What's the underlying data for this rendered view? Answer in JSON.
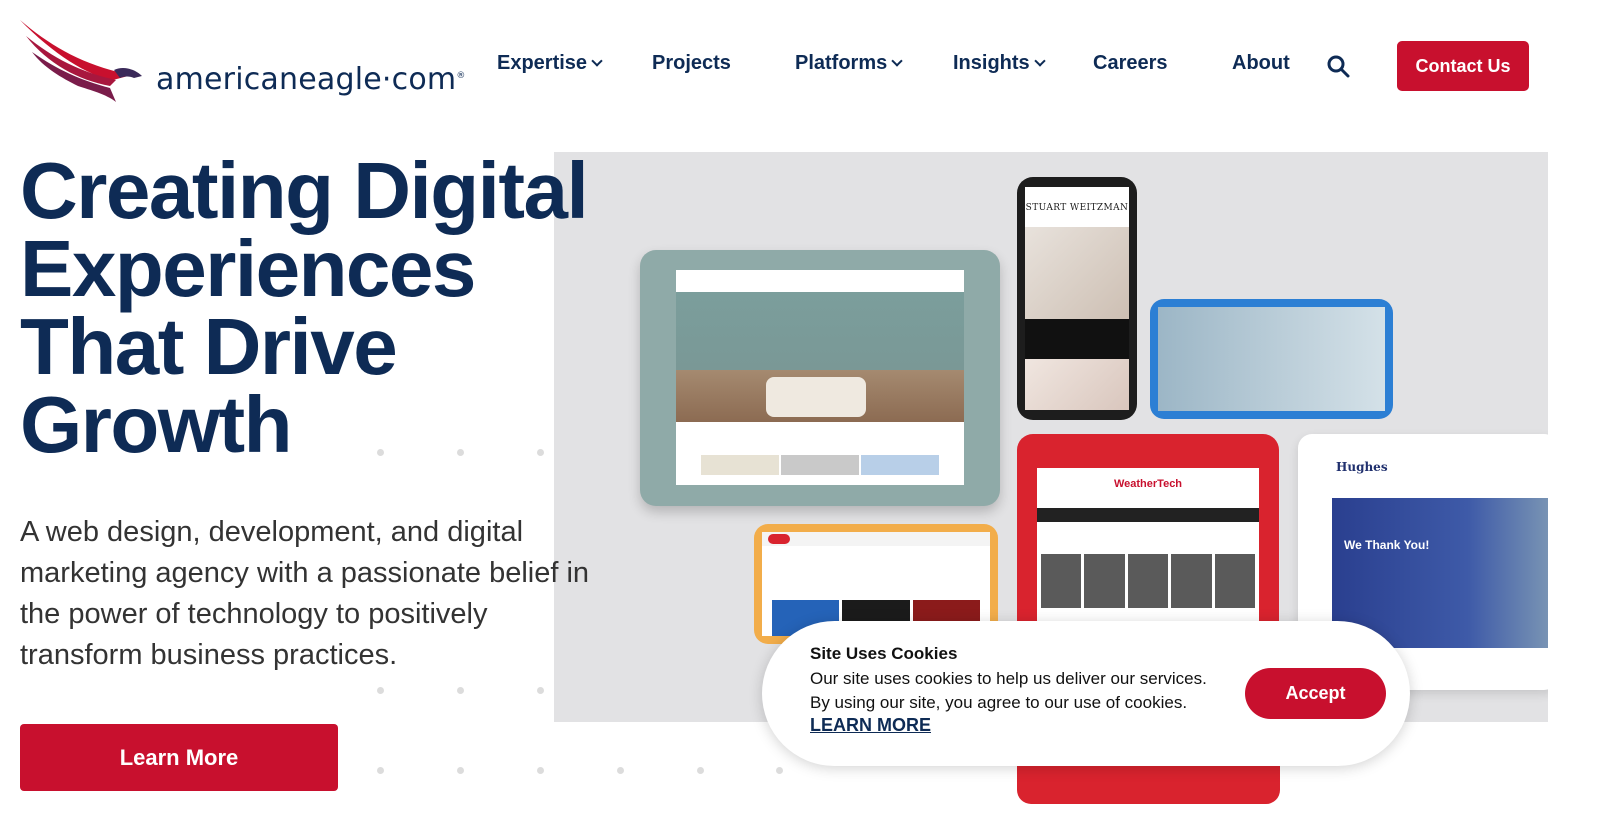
{
  "brand": {
    "logo_text": "americaneagle·com",
    "registered": "®",
    "colors": {
      "navy": "#0e2b55",
      "red": "#c8102e",
      "maroon": "#7a1c4a"
    }
  },
  "nav": {
    "items": [
      {
        "label": "Expertise",
        "dropdown": true
      },
      {
        "label": "Projects",
        "dropdown": false
      },
      {
        "label": "Platforms",
        "dropdown": true
      },
      {
        "label": "Insights",
        "dropdown": true
      },
      {
        "label": "Careers",
        "dropdown": false
      },
      {
        "label": "About",
        "dropdown": false
      }
    ],
    "search_icon": "search-icon",
    "contact_label": "Contact Us"
  },
  "hero": {
    "title_lines": [
      "Creating Digital",
      "Experiences",
      "That Drive",
      "Growth"
    ],
    "subtitle": "A web design, development, and digital marketing agency with a passionate belief in the power of technology to positively transform business practices.",
    "cta_label": "Learn More"
  },
  "mockups": {
    "phone_brand": "STUART WEITZMAN",
    "red_tablet_brand": "WeatherTech",
    "white_tablet_brand": "Hughes",
    "white_tablet_heading": "We Thank You!"
  },
  "cookie": {
    "title": "Site Uses Cookies",
    "text": "Our site uses cookies to help us deliver our services. By using our site, you agree to our use of cookies.",
    "link_label": "LEARN MORE",
    "accept_label": "Accept"
  }
}
